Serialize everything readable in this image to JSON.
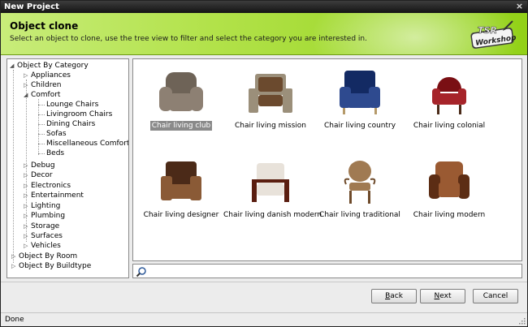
{
  "window": {
    "title": "New Project",
    "close_glyph": "×"
  },
  "header": {
    "title": "Object clone",
    "subtitle": "Select an object to clone, use the tree view to filter and select the category you are interested in.",
    "logo_top": "TSR",
    "logo_bottom": "Workshop"
  },
  "tree": {
    "root_category": "Object By Category",
    "categories": [
      "Appliances",
      "Children",
      "Comfort",
      "Debug",
      "Decor",
      "Electronics",
      "Entertainment",
      "Lighting",
      "Plumbing",
      "Storage",
      "Surfaces",
      "Vehicles"
    ],
    "comfort_children": [
      "Lounge Chairs",
      "Livingroom Chairs",
      "Dining Chairs",
      "Sofas",
      "Miscellaneous Comfort",
      "Beds"
    ],
    "root_room": "Object By Room",
    "root_buildtype": "Object By Buildtype"
  },
  "objects": [
    {
      "label": "Chair living club",
      "selected": true,
      "colors": [
        "#6e6357",
        "#8d8073"
      ]
    },
    {
      "label": "Chair living mission",
      "selected": false,
      "colors": [
        "#6b4a2e",
        "#9b8f7a"
      ]
    },
    {
      "label": "Chair living country",
      "selected": false,
      "colors": [
        "#132a63",
        "#2e4a8f"
      ]
    },
    {
      "label": "Chair living colonial",
      "selected": false,
      "colors": [
        "#7a0f14",
        "#a6242a"
      ]
    },
    {
      "label": "Chair living designer",
      "selected": false,
      "colors": [
        "#4b2a18",
        "#8a5a36"
      ]
    },
    {
      "label": "Chair living danish modern",
      "selected": false,
      "colors": [
        "#5a1e10",
        "#e8e2da"
      ]
    },
    {
      "label": "Chair living traditional",
      "selected": false,
      "colors": [
        "#6e4a2a",
        "#a07a52"
      ]
    },
    {
      "label": "Chair living modern",
      "selected": false,
      "colors": [
        "#5c2d14",
        "#9a5a32"
      ]
    }
  ],
  "search": {
    "value": "",
    "placeholder": ""
  },
  "buttons": {
    "back_u": "B",
    "back_rest": "ack",
    "next_u": "N",
    "next_rest": "ext",
    "cancel": "Cancel"
  },
  "status": {
    "text": "Done"
  }
}
